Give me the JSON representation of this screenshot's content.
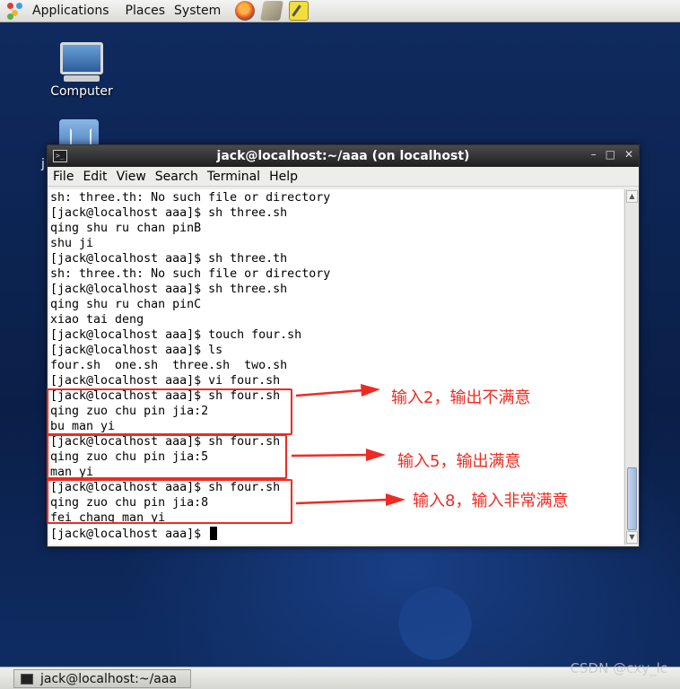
{
  "top_panel": {
    "menus": [
      "Applications",
      "Places",
      "System"
    ],
    "launchers": [
      "firefox-icon",
      "network-icon",
      "notes-icon"
    ]
  },
  "desktop": {
    "computer_label": "Computer",
    "partial_label": "j"
  },
  "terminal": {
    "title": "jack@localhost:~/aaa (on localhost)",
    "window_buttons": [
      "–",
      "□",
      "✕"
    ],
    "menu": [
      "File",
      "Edit",
      "View",
      "Search",
      "Terminal",
      "Help"
    ],
    "lines": [
      "sh: three.th: No such file or directory",
      "[jack@localhost aaa]$ sh three.sh",
      "qing shu ru chan pinB",
      "shu ji",
      "[jack@localhost aaa]$ sh three.th",
      "sh: three.th: No such file or directory",
      "[jack@localhost aaa]$ sh three.sh",
      "qing shu ru chan pinC",
      "xiao tai deng",
      "[jack@localhost aaa]$ touch four.sh",
      "[jack@localhost aaa]$ ls",
      "four.sh  one.sh  three.sh  two.sh",
      "[jack@localhost aaa]$ vi four.sh",
      "[jack@localhost aaa]$ sh four.sh",
      "qing zuo chu pin jia:2",
      "bu man yi",
      "[jack@localhost aaa]$ sh four.sh",
      "qing zuo chu pin jia:5",
      "man yi",
      "[jack@localhost aaa]$ sh four.sh",
      "qing zuo chu pin jia:8",
      "fei chang man yi"
    ],
    "prompt": "[jack@localhost aaa]$ "
  },
  "annotations": [
    "输入2，输出不满意",
    "输入5，输出满意",
    "输入8，输入非常满意"
  ],
  "accent_color": "#ee2b22",
  "taskbar": {
    "task_label": "jack@localhost:~/aaa"
  },
  "watermark": "CSDN @cxy_lc"
}
